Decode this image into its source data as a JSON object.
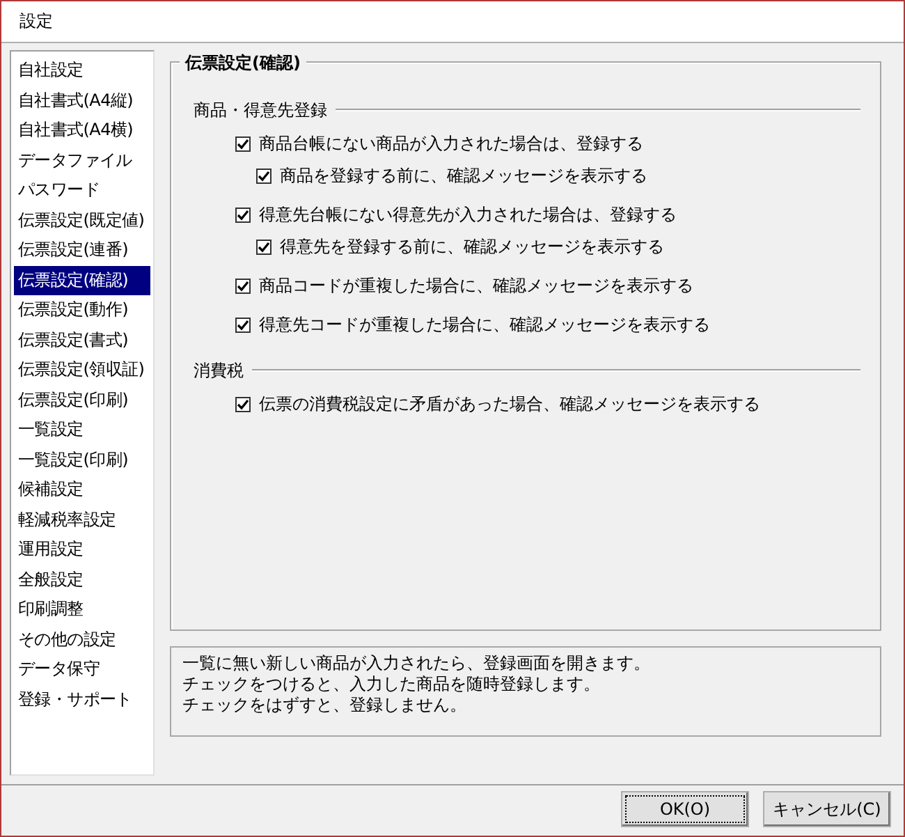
{
  "window": {
    "title": "設定"
  },
  "sidebar": {
    "items": [
      {
        "label": "自社設定",
        "selected": false
      },
      {
        "label": "自社書式(A4縦)",
        "selected": false
      },
      {
        "label": "自社書式(A4横)",
        "selected": false
      },
      {
        "label": "データファイル",
        "selected": false
      },
      {
        "label": "パスワード",
        "selected": false
      },
      {
        "label": "伝票設定(既定値)",
        "selected": false
      },
      {
        "label": "伝票設定(連番)",
        "selected": false
      },
      {
        "label": "伝票設定(確認)",
        "selected": true
      },
      {
        "label": "伝票設定(動作)",
        "selected": false
      },
      {
        "label": "伝票設定(書式)",
        "selected": false
      },
      {
        "label": "伝票設定(領収証)",
        "selected": false
      },
      {
        "label": "伝票設定(印刷)",
        "selected": false
      },
      {
        "label": "一覧設定",
        "selected": false
      },
      {
        "label": "一覧設定(印刷)",
        "selected": false
      },
      {
        "label": "候補設定",
        "selected": false
      },
      {
        "label": "軽減税率設定",
        "selected": false
      },
      {
        "label": "運用設定",
        "selected": false
      },
      {
        "label": "全般設定",
        "selected": false
      },
      {
        "label": "印刷調整",
        "selected": false
      },
      {
        "label": "その他の設定",
        "selected": false
      },
      {
        "label": "データ保守",
        "selected": false
      },
      {
        "label": "登録・サポート",
        "selected": false
      }
    ]
  },
  "panel": {
    "title": "伝票設定(確認)",
    "sections": [
      {
        "title": "商品・得意先登録",
        "options": [
          {
            "label": "商品台帳にない商品が入力された場合は、登録する",
            "checked": true,
            "children": [
              {
                "label": "商品を登録する前に、確認メッセージを表示する",
                "checked": true
              }
            ]
          },
          {
            "label": "得意先台帳にない得意先が入力された場合は、登録する",
            "checked": true,
            "children": [
              {
                "label": "得意先を登録する前に、確認メッセージを表示する",
                "checked": true
              }
            ]
          },
          {
            "label": "商品コードが重複した場合に、確認メッセージを表示する",
            "checked": true
          },
          {
            "label": "得意先コードが重複した場合に、確認メッセージを表示する",
            "checked": true
          }
        ]
      },
      {
        "title": "消費税",
        "options": [
          {
            "label": "伝票の消費税設定に矛盾があった場合、確認メッセージを表示する",
            "checked": true
          }
        ]
      }
    ]
  },
  "description": [
    "一覧に無い新しい商品が入力されたら、登録画面を開きます。",
    "チェックをつけると、入力した商品を随時登録します。",
    "チェックをはずすと、登録しません。"
  ],
  "buttons": [
    {
      "label": "OK(O)",
      "focused": true
    },
    {
      "label": "キャンセル(C)",
      "focused": false
    }
  ]
}
